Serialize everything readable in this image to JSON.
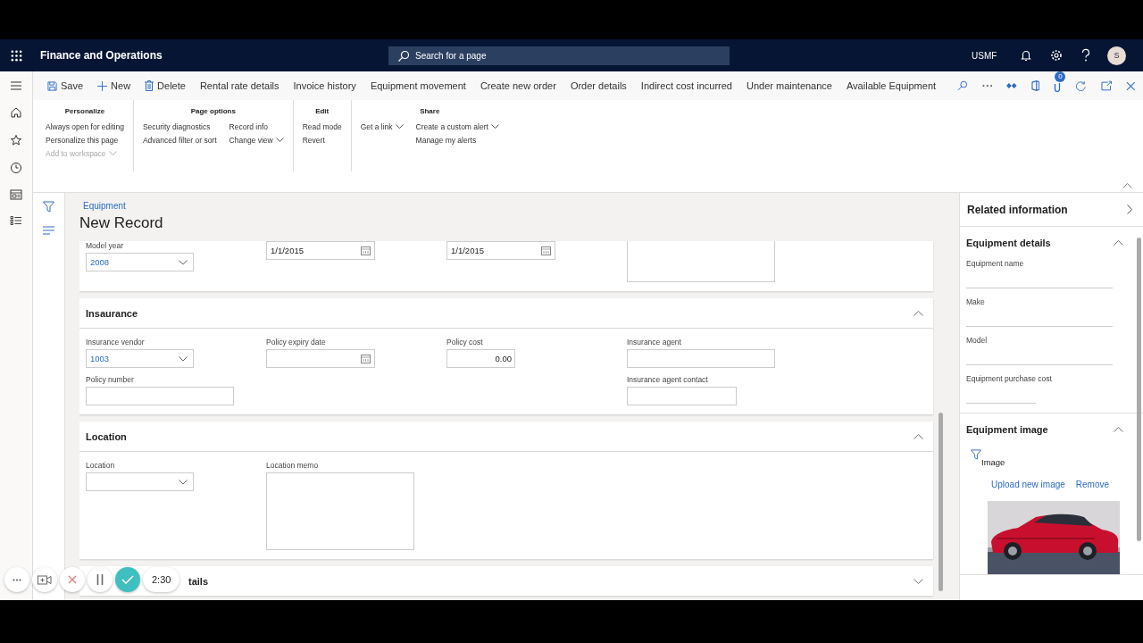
{
  "app_bar": {
    "title": "Finance and Operations",
    "search_placeholder": "Search for a page",
    "company": "USMF",
    "avatar": "S"
  },
  "action_pane": {
    "buttons": [
      "Save",
      "New",
      "Delete",
      "Rental rate details",
      "Invoice history",
      "Equipment movement",
      "Create new order",
      "Order details",
      "Indirect cost incurred",
      "Under maintenance",
      "Available Equipment"
    ],
    "message_count": "0"
  },
  "ribbon": {
    "groups": [
      {
        "title": "Personalize",
        "columns": [
          [
            {
              "label": "Always open for editing",
              "disabled": false,
              "dropdown": false
            },
            {
              "label": "Personalize this page",
              "disabled": false,
              "dropdown": false
            },
            {
              "label": "Add to workspace",
              "disabled": true,
              "dropdown": true
            }
          ]
        ]
      },
      {
        "title": "Page options",
        "columns": [
          [
            {
              "label": "Security diagnostics",
              "disabled": false,
              "dropdown": false
            },
            {
              "label": "Advanced filter or sort",
              "disabled": false,
              "dropdown": false
            }
          ],
          [
            {
              "label": "Record info",
              "disabled": false,
              "dropdown": false
            },
            {
              "label": "Change view",
              "disabled": false,
              "dropdown": true
            }
          ]
        ]
      },
      {
        "title": "Edit",
        "columns": [
          [
            {
              "label": "Read mode",
              "disabled": false,
              "dropdown": false
            },
            {
              "label": "Revert",
              "disabled": false,
              "dropdown": false
            }
          ]
        ]
      },
      {
        "title": "Share",
        "columns": [
          [
            {
              "label": "Get a link",
              "disabled": false,
              "dropdown": true
            }
          ],
          [
            {
              "label": "Create a custom alert",
              "disabled": false,
              "dropdown": true
            },
            {
              "label": "Manage my alerts",
              "disabled": false,
              "dropdown": false
            }
          ]
        ]
      }
    ]
  },
  "page": {
    "breadcrumb": "Equipment",
    "title": "New Record",
    "sections": [
      {
        "columns": [
          [
            {
              "label": "Model year",
              "kind": "select",
              "value": "2008"
            }
          ],
          [
            {
              "kind": "date",
              "value": "1/1/2015"
            }
          ],
          [
            {
              "kind": "date",
              "value": "1/1/2015"
            }
          ],
          [
            {
              "kind": "textarea"
            }
          ]
        ]
      },
      {
        "title": "Insaurance",
        "expanded": true,
        "columns": [
          [
            {
              "label": "Insurance vendor",
              "kind": "select",
              "value": "1003"
            },
            {
              "label": "Policy number",
              "kind": "text"
            }
          ],
          [
            {
              "label": "Policy expiry date",
              "kind": "date"
            }
          ],
          [
            {
              "label": "Policy cost",
              "kind": "number",
              "value": "0.00"
            }
          ],
          [
            {
              "label": "Insurance agent",
              "kind": "text"
            },
            {
              "label": "Insurance agent contact",
              "kind": "short"
            }
          ]
        ]
      },
      {
        "title": "Location",
        "expanded": true,
        "columns": [
          [
            {
              "label": "Location",
              "kind": "select"
            }
          ],
          [
            {
              "label": "Location memo",
              "kind": "textarea"
            }
          ]
        ]
      },
      {
        "title": "tails",
        "expanded": false
      }
    ]
  },
  "related": {
    "title": "Related information",
    "panels": [
      {
        "title": "Equipment details",
        "expanded": true,
        "fields": [
          "Equipment name",
          "Make",
          "Model",
          "Equipment purchase cost"
        ]
      },
      {
        "title": "Equipment image",
        "expanded": true,
        "image_label": "Image",
        "links": [
          "Upload new image",
          "Remove"
        ],
        "image": {
          "kind": "picture"
        }
      }
    ]
  },
  "recorder": {
    "time": "2:30"
  }
}
